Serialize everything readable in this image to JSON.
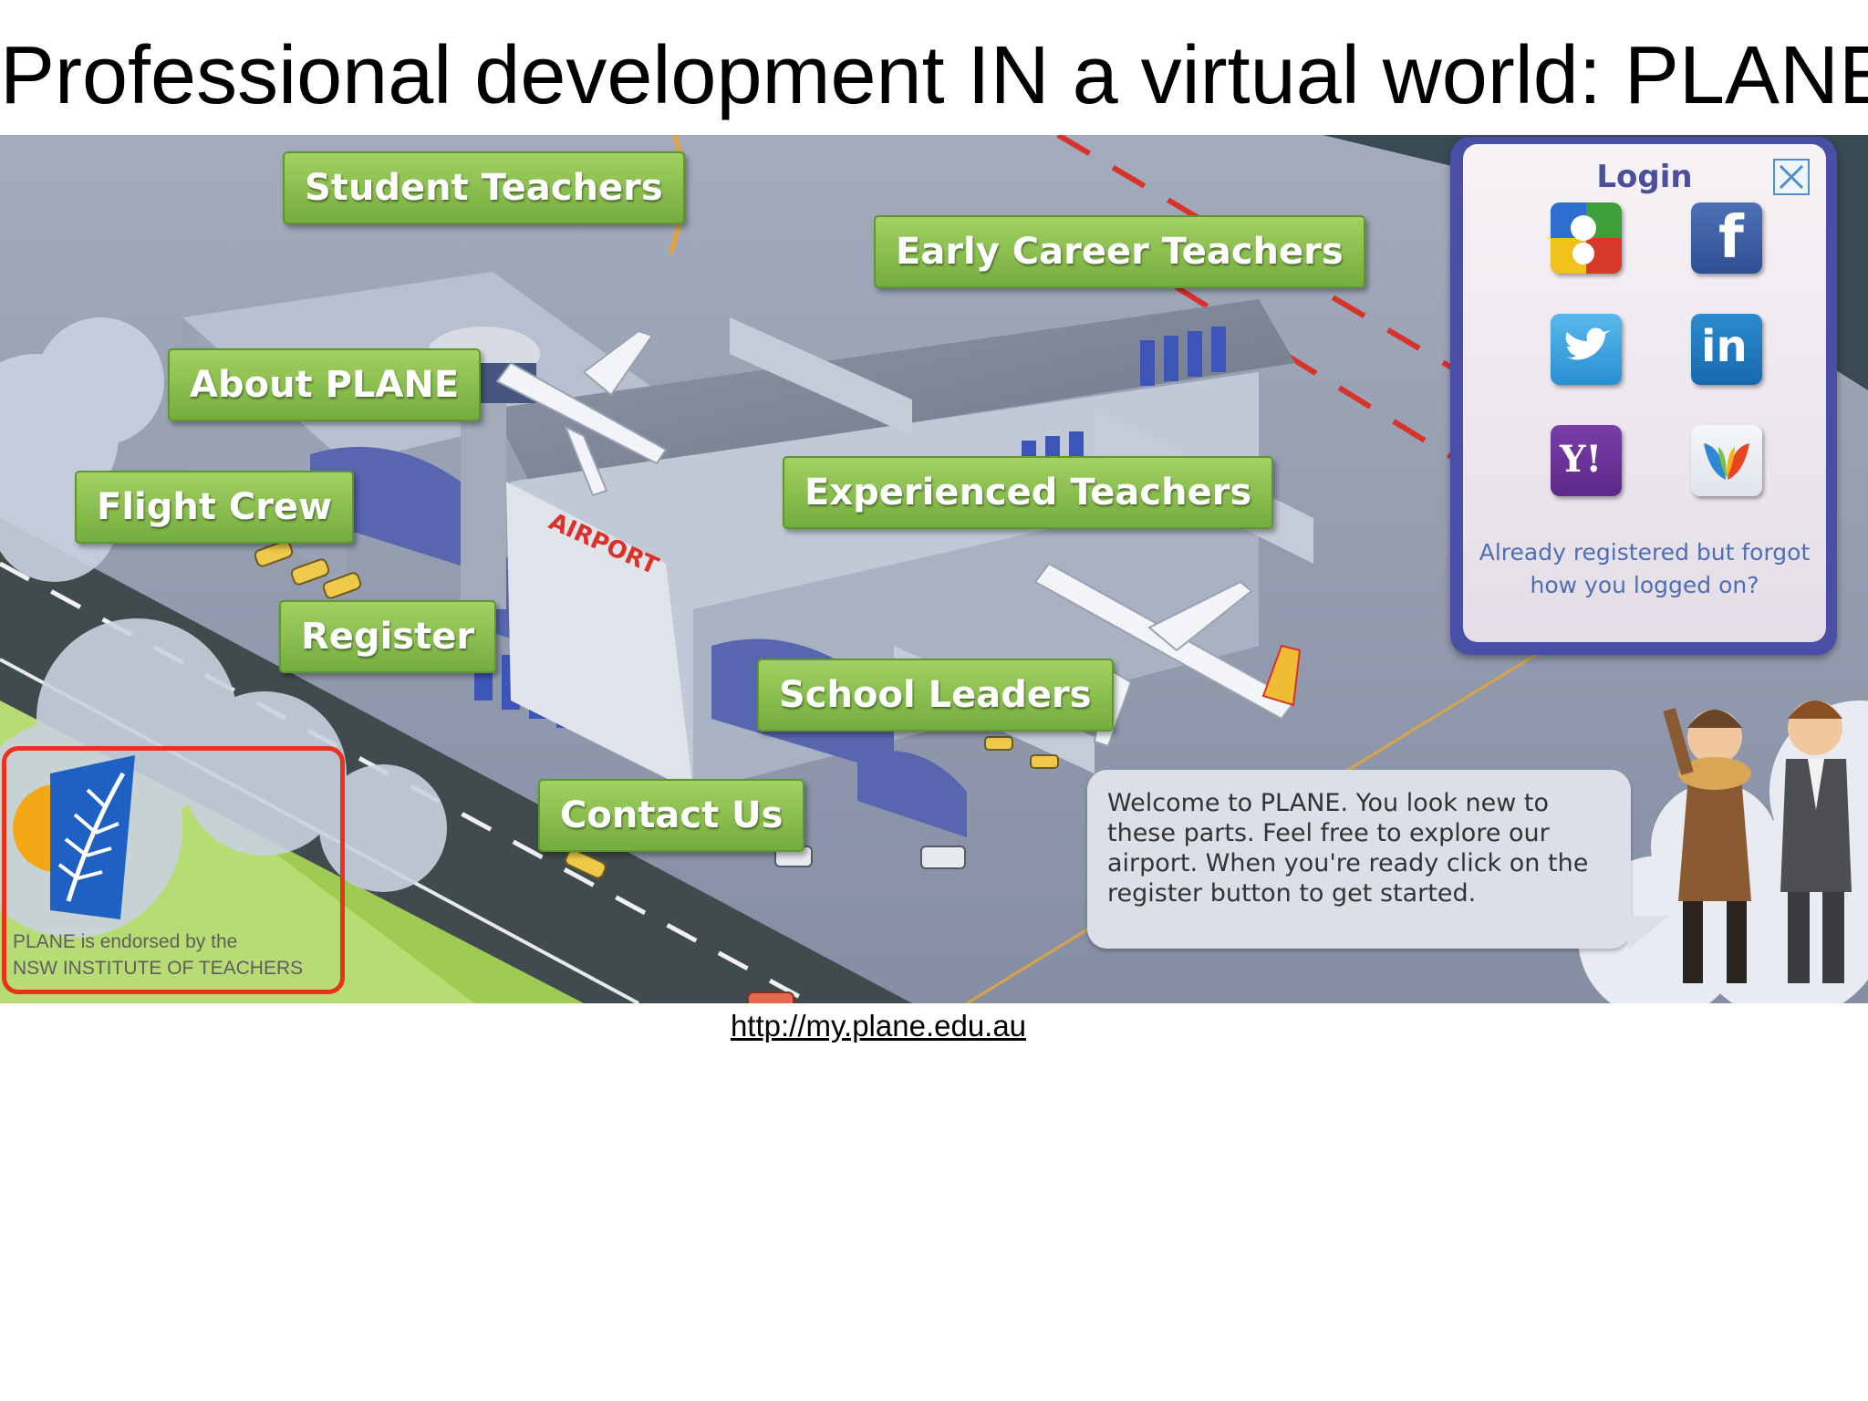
{
  "slide": {
    "title": "Professional development IN a virtual world: PLANE",
    "url": "http://my.plane.edu.au"
  },
  "nav": {
    "student_teachers": "Student Teachers",
    "early_career_teachers": "Early Career Teachers",
    "about_plane": "About PLANE",
    "flight_crew": "Flight Crew",
    "experienced_teachers": "Experienced Teachers",
    "register": "Register",
    "school_leaders": "School Leaders",
    "contact_us": "Contact Us"
  },
  "scene": {
    "terminal_sign": "AIRPORT"
  },
  "login": {
    "title": "Login",
    "forgot_line1": "Already registered but forgot",
    "forgot_line2": "how you logged on?",
    "providers": [
      "google-icon",
      "facebook-icon",
      "twitter-icon",
      "linkedin-icon",
      "yahoo-icon",
      "windows-live-icon"
    ],
    "facebook_glyph": "f",
    "linkedin_glyph": "in",
    "yahoo_glyph": "Y!"
  },
  "welcome": {
    "message": "Welcome to PLANE. You look new to these parts. Feel free to explore our airport. When you're ready click on the register button to get started."
  },
  "endorsement": {
    "line1": "PLANE is endorsed by the",
    "line2": "NSW INSTITUTE OF TEACHERS"
  },
  "colors": {
    "nav_green": "#82b84a",
    "login_border": "#4a4fa6",
    "highlight_red": "#e8321c",
    "ground": "#8e97ab"
  }
}
